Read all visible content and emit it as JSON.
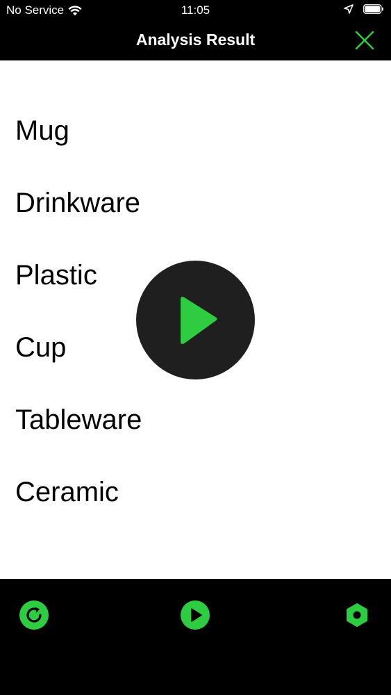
{
  "status_bar": {
    "carrier": "No Service",
    "time": "11:05"
  },
  "nav": {
    "title": "Analysis Result"
  },
  "results": [
    "Mug",
    "Drinkware",
    "Plastic",
    "Cup",
    "Tableware",
    "Ceramic"
  ],
  "icons": {
    "close": "close-icon",
    "play_overlay": "play-icon",
    "refresh": "refresh-icon",
    "play": "play-icon",
    "settings": "hexagon-gear-icon"
  },
  "colors": {
    "accent": "#2ecc40",
    "background": "#000000",
    "content": "#ffffff",
    "overlay": "#1f1f1f"
  }
}
